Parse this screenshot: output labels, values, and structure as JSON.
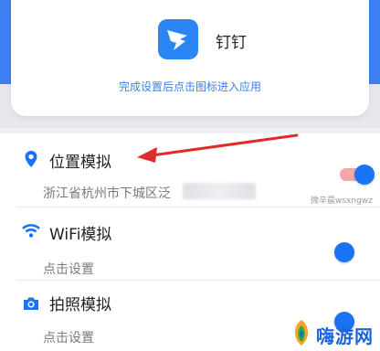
{
  "app": {
    "name": "钉钉",
    "hint": "完成设置后点击图标进入应用",
    "icon": "dingtalk-logo-icon"
  },
  "rows": [
    {
      "title": "位置模拟",
      "subtitle": "浙江省杭州市下城区泛",
      "icon": "location-pin-icon",
      "enabled": true
    },
    {
      "title": "WiFi模拟",
      "subtitle": "点击设置",
      "icon": "wifi-icon",
      "enabled": false
    },
    {
      "title": "拍照模拟",
      "subtitle": "点击设置",
      "icon": "camera-icon",
      "enabled": false
    }
  ],
  "watermark": {
    "text": "微辛晨wsxngwz"
  },
  "brand": {
    "text": "嗨游网"
  },
  "colors": {
    "accent": "#1a73f2",
    "header_blue": "#3e7ff2",
    "arrow": "#e02b2b",
    "toggle_on_track": "#f2a6a6",
    "toggle_off_track": "#ffffff"
  }
}
